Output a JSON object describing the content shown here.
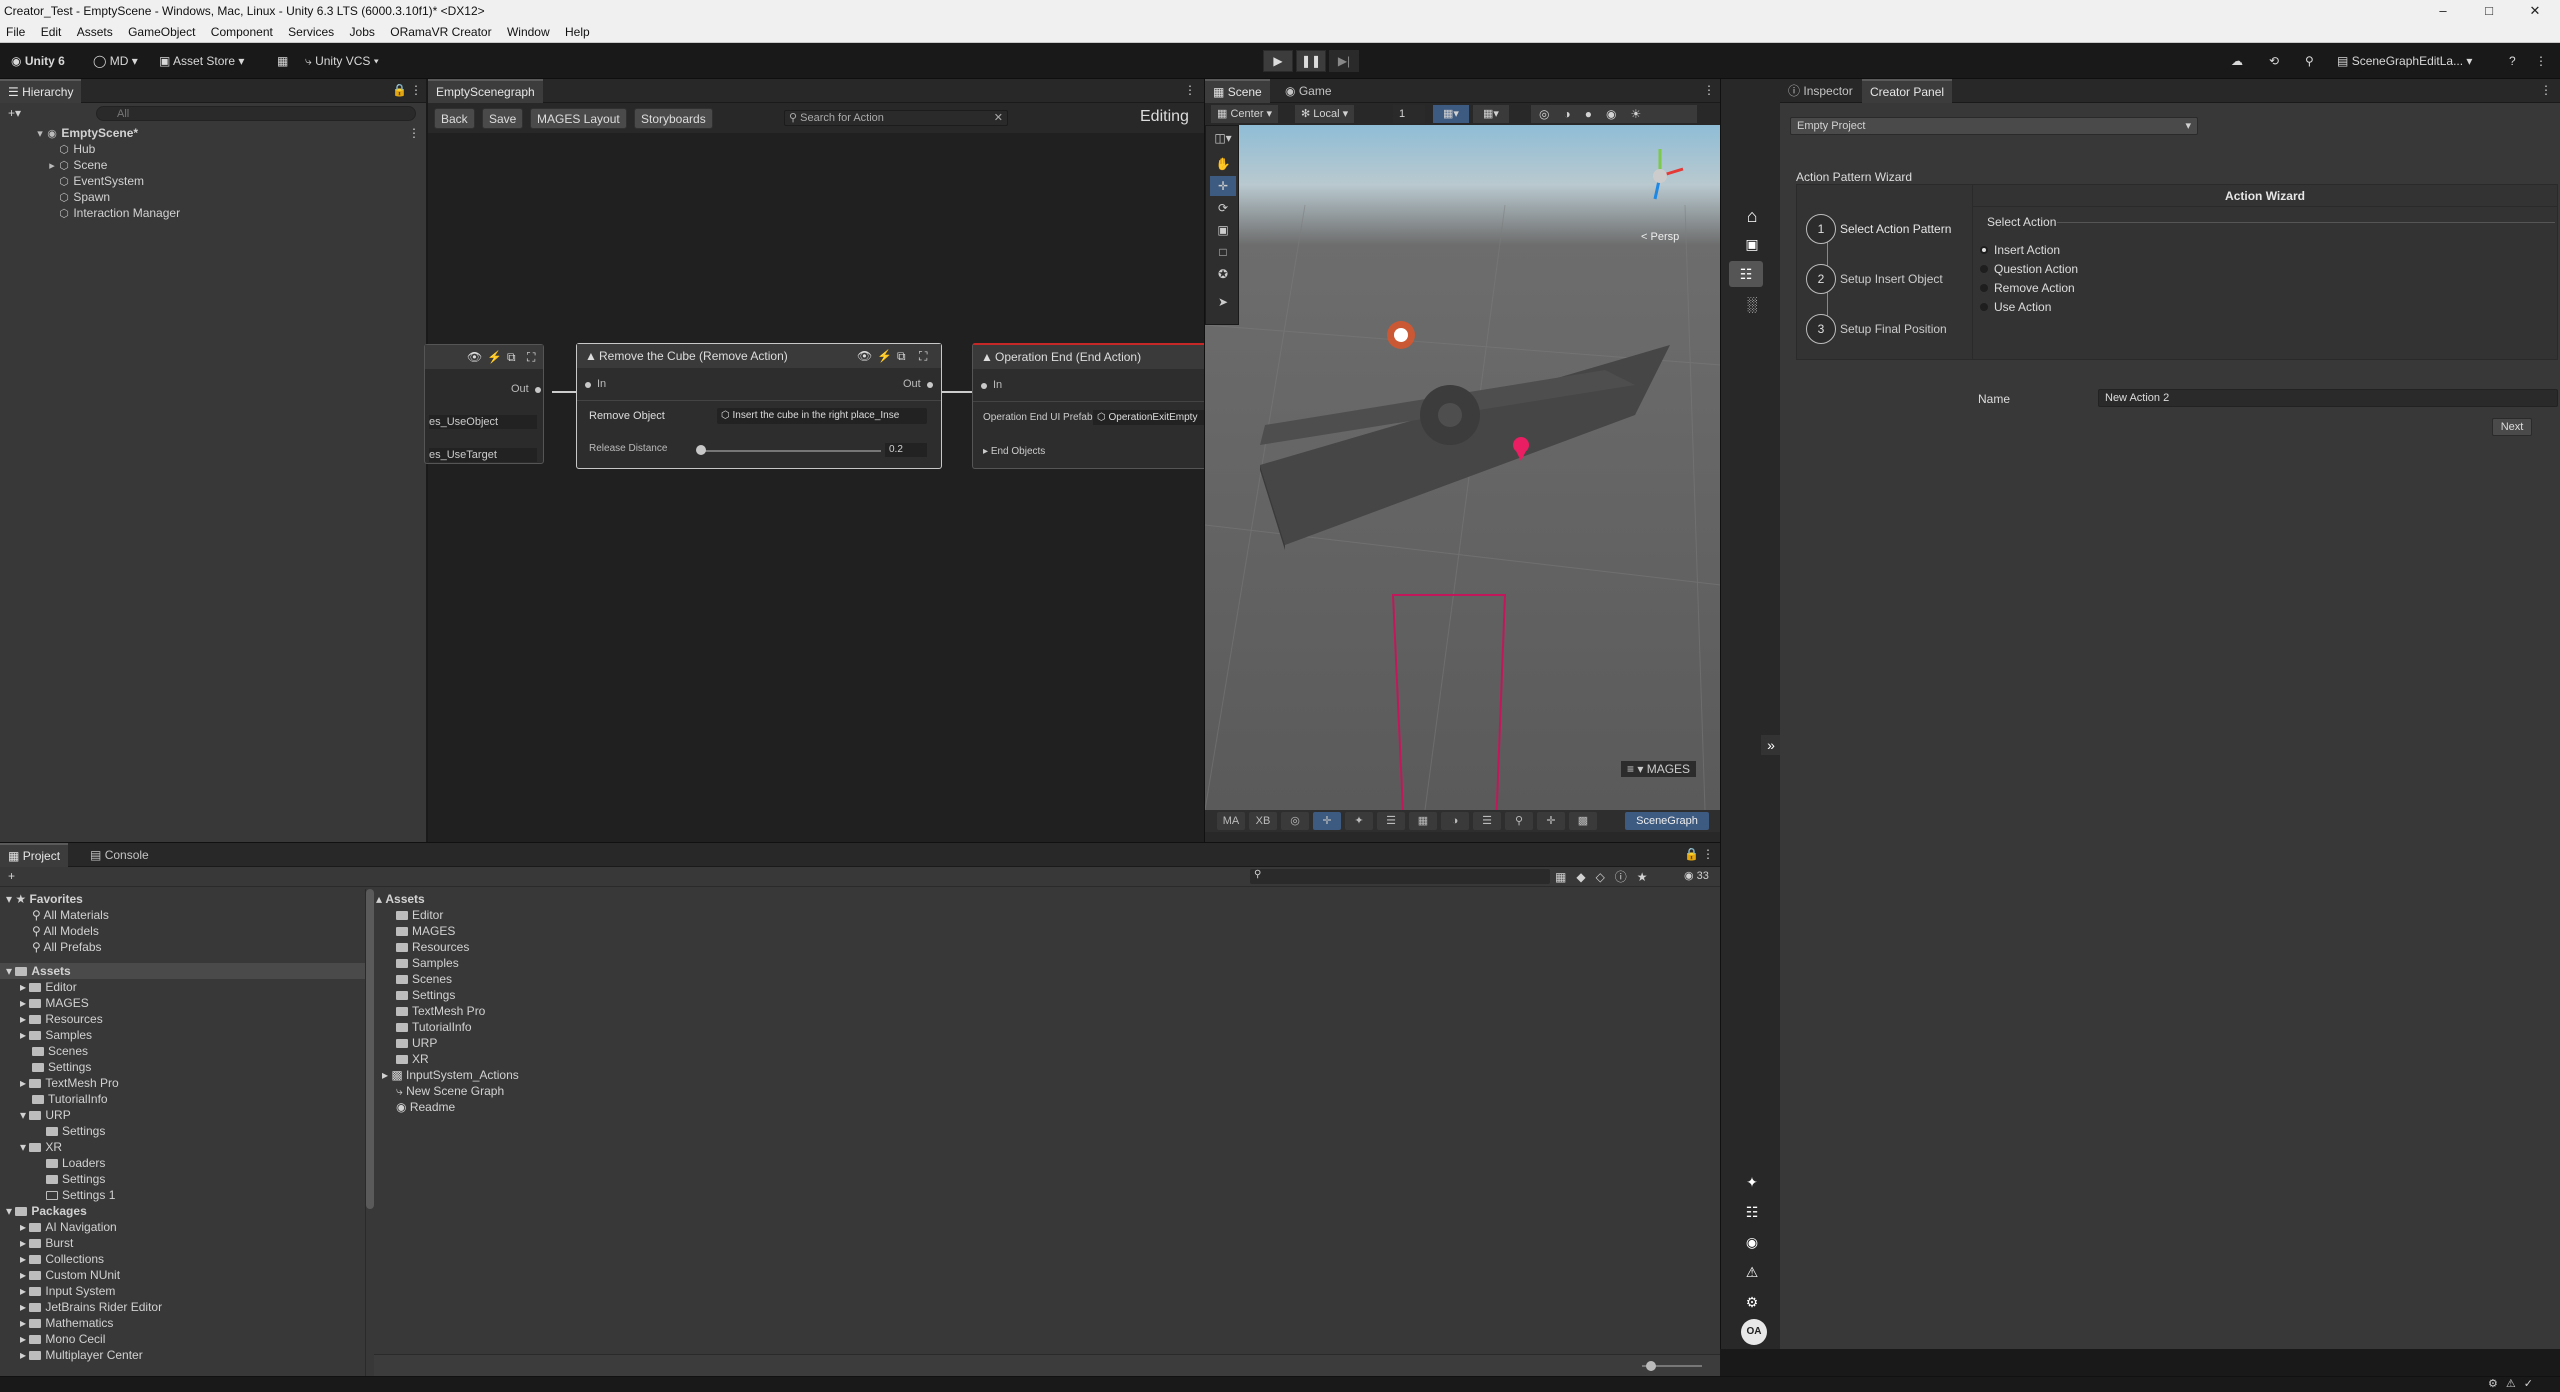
{
  "window": {
    "title": "Creator_Test - EmptyScene - Windows, Mac, Linux - Unity 6.3 LTS (6000.3.10f1)* <DX12>"
  },
  "menu": [
    "File",
    "Edit",
    "Assets",
    "GameObject",
    "Component",
    "Services",
    "Jobs",
    "ORamaVR Creator",
    "Window",
    "Help"
  ],
  "toolbar": {
    "unity": "Unity 6",
    "account": "MD",
    "asset_store": "Asset Store",
    "vcs": "Unity VCS",
    "layout": "SceneGraphEditLa..."
  },
  "hierarchy": {
    "tab": "Hierarchy",
    "search_placeholder": "All",
    "scene": "EmptyScene*",
    "items": [
      "Hub",
      "Scene",
      "EventSystem",
      "Spawn",
      "Interaction Manager"
    ]
  },
  "graph": {
    "tab": "EmptyScenegraph",
    "back": "Back",
    "save": "Save",
    "mages_layout": "MAGES Layout",
    "storyboards": "Storyboards",
    "search_placeholder": "Search for Action",
    "mode": "Editing",
    "left_node": {
      "out": "Out",
      "field1": "es_UseObject",
      "field2": "es_UseTarget"
    },
    "remove_node": {
      "title": "Remove the Cube (Remove Action)",
      "in": "In",
      "out": "Out",
      "remove_label": "Remove Object",
      "remove_value": "Insert the cube in the right place_Inse",
      "release_label": "Release Distance",
      "release_value": "0.2",
      "release_fraction": 0.02
    },
    "end_node": {
      "title": "Operation End (End Action)",
      "in": "In",
      "prefab_label": "Operation End UI Prefab",
      "prefab_value": "OperationExitEmpty",
      "end_objects": "End Objects"
    }
  },
  "scene": {
    "tab_scene": "Scene",
    "tab_game": "Game",
    "pivot": "Center",
    "space": "Local",
    "grid": "1",
    "persp": "Persp",
    "overlay_label": "MAGES",
    "bottom_tools": [
      "MA",
      "XB"
    ],
    "scenegraph_btn": "SceneGraph"
  },
  "inspector": {
    "tab_inspector": "Inspector",
    "tab_creator": "Creator Panel",
    "project_select": "Empty Project",
    "wizard_title": "Action Pattern Wizard",
    "wizard_header": "Action Wizard",
    "steps": [
      {
        "num": "1",
        "label": "Select Action Pattern"
      },
      {
        "num": "2",
        "label": "Setup Insert Object"
      },
      {
        "num": "3",
        "label": "Setup Final Position"
      }
    ],
    "select_label": "Select Action",
    "options": [
      "Insert Action",
      "Question Action",
      "Remove Action",
      "Use Action"
    ],
    "selected": "Insert Action",
    "name_label": "Name",
    "name_value": "New Action 2",
    "next": "Next",
    "avatar": "OA"
  },
  "project": {
    "tab_project": "Project",
    "tab_console": "Console",
    "count": "33",
    "favorites": {
      "label": "Favorites",
      "items": [
        "All Materials",
        "All Models",
        "All Prefabs"
      ]
    },
    "assets_label": "Assets",
    "tree_assets": [
      "Editor",
      "MAGES",
      "Resources",
      "Samples",
      "Scenes",
      "Settings",
      "TextMesh Pro",
      "TutorialInfo",
      "URP",
      "Settings",
      "XR",
      "Loaders",
      "Settings",
      "Settings 1"
    ],
    "packages_label": "Packages",
    "tree_packages": [
      "AI Navigation",
      "Burst",
      "Collections",
      "Custom NUnit",
      "Input System",
      "JetBrains Rider Editor",
      "Mathematics",
      "Mono Cecil",
      "Multiplayer Center"
    ],
    "breadcrumb": "Assets",
    "contents": [
      "Editor",
      "MAGES",
      "Resources",
      "Samples",
      "Scenes",
      "Settings",
      "TextMesh Pro",
      "TutorialInfo",
      "URP",
      "XR",
      "InputSystem_Actions",
      "New Scene Graph",
      "Readme"
    ]
  }
}
